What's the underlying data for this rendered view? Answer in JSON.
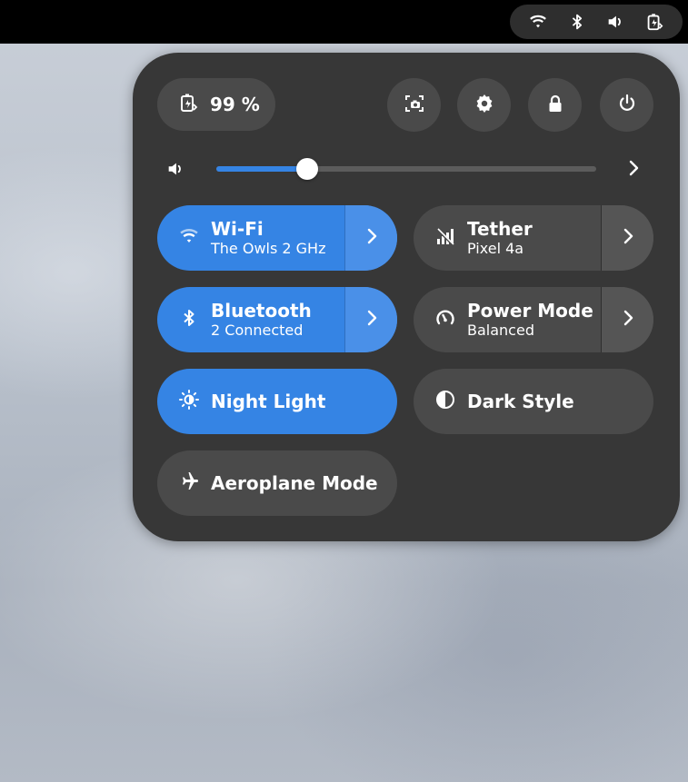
{
  "topbar": {
    "tray_icons": [
      "wifi-icon",
      "bluetooth-icon",
      "volume-icon",
      "battery-charging-icon"
    ]
  },
  "quick_settings": {
    "battery": {
      "icon": "battery-charging-icon",
      "label": "99 %"
    },
    "buttons": [
      {
        "name": "screenshot-button",
        "icon": "screenshot-icon"
      },
      {
        "name": "settings-button",
        "icon": "gear-icon"
      },
      {
        "name": "lock-button",
        "icon": "lock-icon"
      },
      {
        "name": "power-button",
        "icon": "power-icon"
      }
    ],
    "volume": {
      "icon": "volume-icon",
      "level": 0.24
    },
    "tiles": {
      "wifi": {
        "title": "Wi-Fi",
        "subtitle": "The Owls 2 GHz",
        "active": true
      },
      "tether": {
        "title": "Tether",
        "subtitle": "Pixel 4a",
        "active": false
      },
      "bluetooth": {
        "title": "Bluetooth",
        "subtitle": "2 Connected",
        "active": true
      },
      "power_mode": {
        "title": "Power Mode",
        "subtitle": "Balanced",
        "active": false
      },
      "night_light": {
        "title": "Night Light",
        "active": true
      },
      "dark_style": {
        "title": "Dark Style",
        "active": false
      },
      "aeroplane": {
        "title": "Aeroplane Mode",
        "active": false
      }
    }
  },
  "colors": {
    "accent": "#3584e4",
    "panel_bg": "#373737",
    "button_bg": "#4a4a4a"
  }
}
